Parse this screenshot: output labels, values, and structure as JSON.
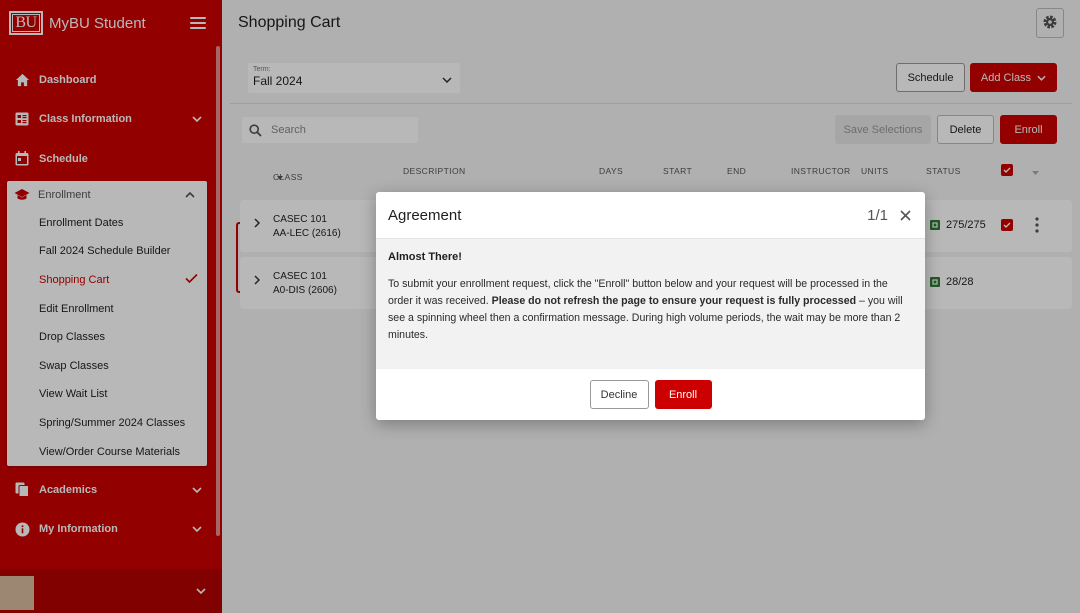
{
  "app": {
    "logo_text": "BU",
    "title": "MyBU Student"
  },
  "sidebar": {
    "items_top": [
      {
        "label": "Dashboard",
        "icon": "home-icon"
      },
      {
        "label": "Class Information",
        "icon": "class-info-icon"
      },
      {
        "label": "Schedule",
        "icon": "calendar-icon"
      }
    ],
    "enrollment": {
      "label": "Enrollment",
      "icon": "graduation-cap-icon",
      "subitems": [
        "Enrollment Dates",
        "Fall 2024 Schedule Builder",
        "Shopping Cart",
        "Edit Enrollment",
        "Drop Classes",
        "Swap Classes",
        "View Wait List",
        "Spring/Summer 2024 Classes",
        "View/Order Course Materials"
      ],
      "active_index": 2
    },
    "items_bottom": [
      {
        "label": "Academics",
        "icon": "documents-icon"
      },
      {
        "label": "My Information",
        "icon": "info-icon"
      }
    ]
  },
  "page": {
    "title": "Shopping Cart"
  },
  "term": {
    "label": "Term:",
    "value": "Fall 2024"
  },
  "toolbar": {
    "schedule": "Schedule",
    "add_class": "Add Class",
    "save_selections": "Save Selections",
    "delete": "Delete",
    "enroll": "Enroll"
  },
  "search": {
    "placeholder": "Search"
  },
  "table": {
    "headers": [
      "CLASS",
      "DESCRIPTION",
      "DAYS",
      "START",
      "END",
      "INSTRUCTOR",
      "UNITS",
      "STATUS"
    ],
    "rows": [
      {
        "course": "CASEC 101",
        "section": "AA-LEC (2616)",
        "status": "275/275",
        "selected": true
      },
      {
        "course": "CASEC 101",
        "section": "A0-DIS (2606)",
        "status": "28/28",
        "selected": false
      }
    ]
  },
  "modal": {
    "title": "Agreement",
    "pager": "1/1",
    "heading": "Almost There!",
    "text_before": "To submit your enrollment request, click the \"Enroll\" button below and your request will be processed in the order it was received. ",
    "text_bold": "Please do not refresh the page to ensure your request is fully processed",
    "text_after": " – you will see a spinning wheel then a confirmation message. During high volume periods, the wait may be more than 2 minutes.",
    "decline": "Decline",
    "enroll": "Enroll"
  },
  "colors": {
    "brand_red": "#cc0000",
    "status_green": "#2e7d32"
  }
}
